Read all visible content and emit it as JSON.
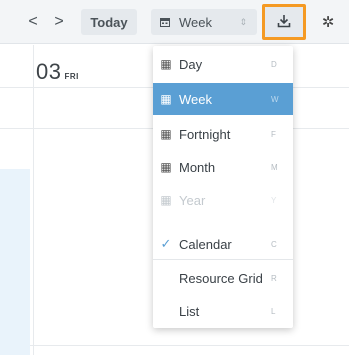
{
  "toolbar": {
    "prev_icon": "chevron-left-icon",
    "prev_glyph": "<",
    "next_icon": "chevron-right-icon",
    "next_glyph": ">",
    "today_label": "Today",
    "view_select": {
      "icon": "calendar-icon",
      "value": "Week",
      "sort_glyph": "⇕"
    },
    "export_icon": "download-icon",
    "settings_icon": "gear-icon",
    "settings_glyph": "✲",
    "highlight_color": "#f59a23"
  },
  "calendar": {
    "day_number": "03",
    "day_of_week": "FRI"
  },
  "view_menu": {
    "items": [
      {
        "label": "Day",
        "shortcut": "D",
        "icon": "calendar-icon"
      },
      {
        "label": "Week",
        "shortcut": "W",
        "icon": "calendar-icon",
        "selected": true
      },
      {
        "label": "Fortnight",
        "shortcut": "F",
        "icon": "calendar-icon"
      },
      {
        "label": "Month",
        "shortcut": "M",
        "icon": "calendar-icon"
      },
      {
        "label": "Year",
        "shortcut": "Y",
        "icon": "calendar-icon",
        "disabled": true
      }
    ],
    "modes": [
      {
        "label": "Calendar",
        "shortcut": "C",
        "icon": "check-icon",
        "checked": true
      },
      {
        "label": "Resource Grid",
        "shortcut": "R"
      },
      {
        "label": "List",
        "shortcut": "L"
      }
    ],
    "selected_color": "#5a9fd4"
  }
}
